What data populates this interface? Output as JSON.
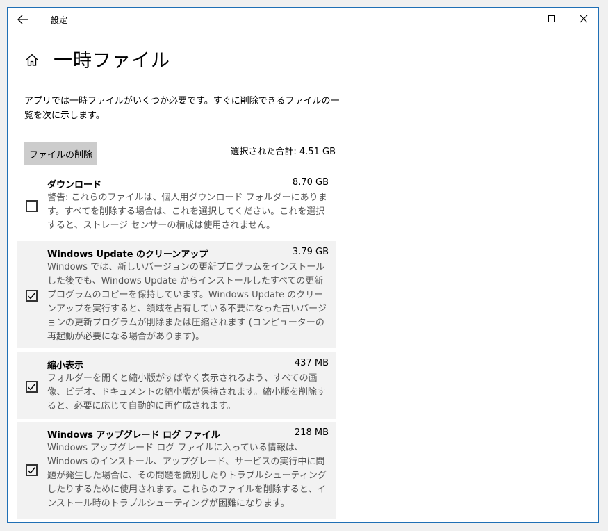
{
  "window": {
    "title": "設定",
    "accent_color": "#1f6fb5"
  },
  "page": {
    "title": "一時ファイル",
    "description": "アプリでは一時ファイルがいくつか必要です。すぐに削除できるファイルの一覧を次に示します。",
    "delete_button_label": "ファイルの削除",
    "total_selected": "選択された合計: 4.51 GB"
  },
  "items": [
    {
      "name": "ダウンロード",
      "size": "8.70 GB",
      "description": "警告: これらのファイルは、個人用ダウンロード フォルダーにあります。すべてを削除する場合は、これを選択してください。これを選択すると、ストレージ センサーの構成は使用されません。",
      "checked": false
    },
    {
      "name": "Windows Update のクリーンアップ",
      "size": "3.79 GB",
      "description": "Windows では、新しいバージョンの更新プログラムをインストールした後でも、Windows Update からインストールしたすべての更新プログラムのコピーを保持しています。Windows Update のクリーンアップを実行すると、領域を占有している不要になった古いバージョンの更新プログラムが削除または圧縮されます (コンピューターの再起動が必要になる場合があります)。",
      "checked": true
    },
    {
      "name": "縮小表示",
      "size": "437 MB",
      "description": "フォルダーを開くと縮小版がすばやく表示されるよう、すべての画像、ビデオ、ドキュメントの縮小版が保持されます。縮小版を削除すると、必要に応じて自動的に再作成されます。",
      "checked": true
    },
    {
      "name": "Windows アップグレード ログ ファイル",
      "size": "218 MB",
      "description": "Windows アップグレード ログ ファイルに入っている情報は、Windows のインストール、アップグレード、サービスの実行中に問題が発生した場合に、その問題を識別したりトラブルシューティングしたりするために使用されます。これらのファイルを削除すると、インストール時のトラブルシューティングが困難になります。",
      "checked": true
    }
  ]
}
